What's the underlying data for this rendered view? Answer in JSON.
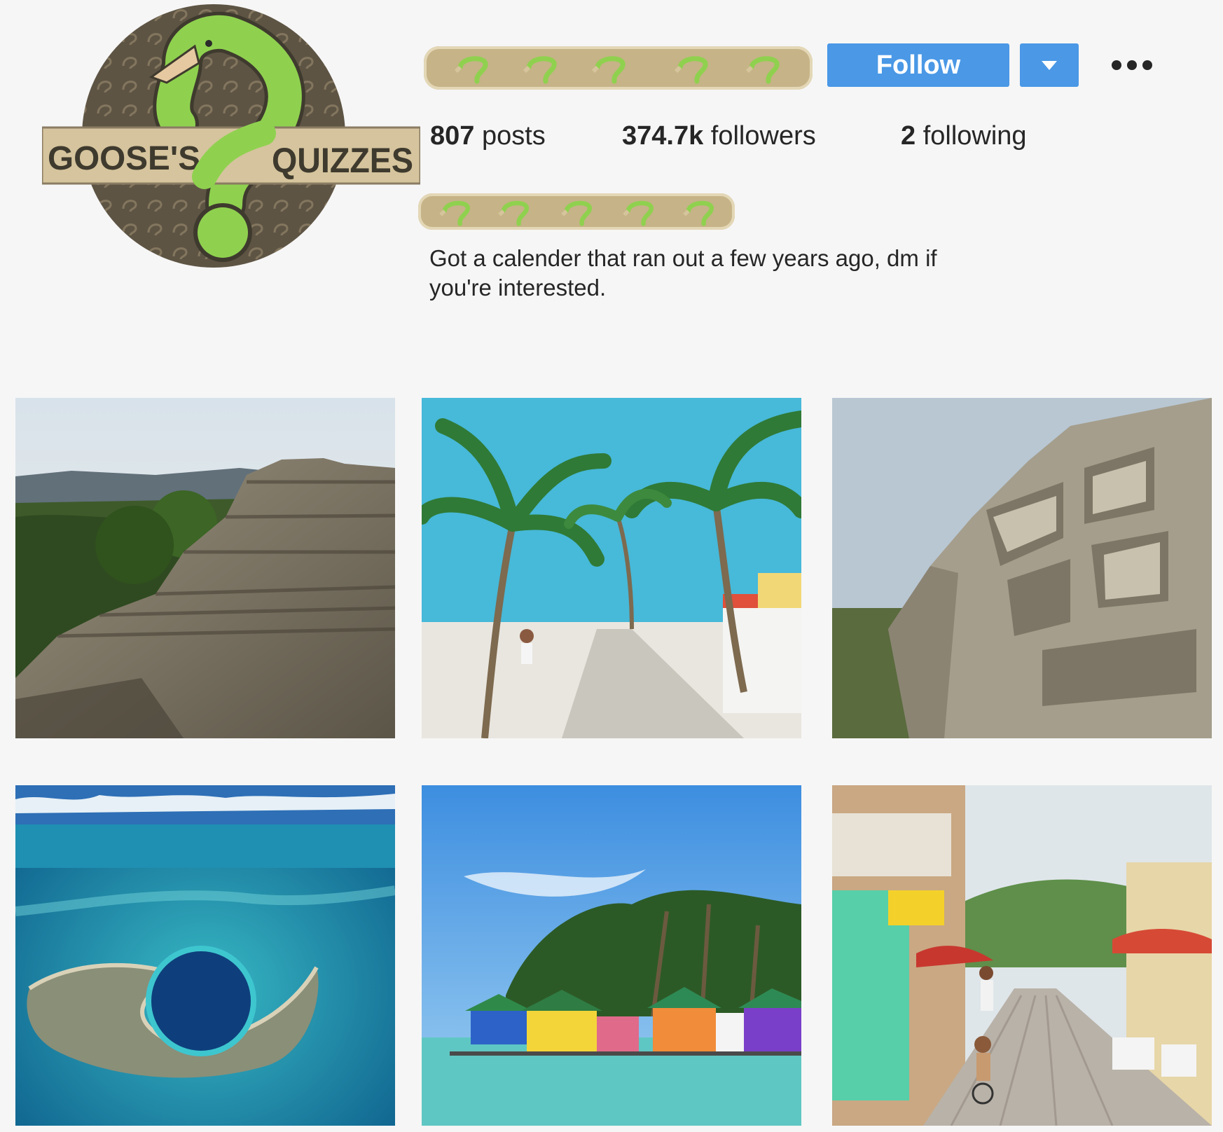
{
  "profile": {
    "avatar_icon": "goose-quizzes-logo-icon",
    "logo_text": {
      "left": "GOOSE'S",
      "right": "QUIZZES"
    },
    "username_redacted": true,
    "fullname_redacted": true,
    "follow_label": "Follow",
    "dropdown_icon": "chevron-down-icon",
    "more_icon": "more-options-icon",
    "stats": {
      "posts": {
        "count": "807",
        "label": "posts"
      },
      "followers": {
        "count": "374.7k",
        "label": "followers"
      },
      "following": {
        "count": "2",
        "label": "following"
      }
    },
    "bio": {
      "line1": "Got a calender that ran out a few years ago, dm if",
      "line2": "you're interested."
    }
  },
  "colors": {
    "accent": "#4a98e6",
    "redaction": "#c6b387",
    "logo_green": "#8fd14f",
    "logo_brown": "#5e5444"
  },
  "posts": [
    {
      "subject": "mayan-pyramid-ruins"
    },
    {
      "subject": "palm-tree-beach-path"
    },
    {
      "subject": "carved-stone-frieze"
    },
    {
      "subject": "great-blue-hole-aerial"
    },
    {
      "subject": "overwater-cabanas"
    },
    {
      "subject": "town-street-scene"
    }
  ]
}
